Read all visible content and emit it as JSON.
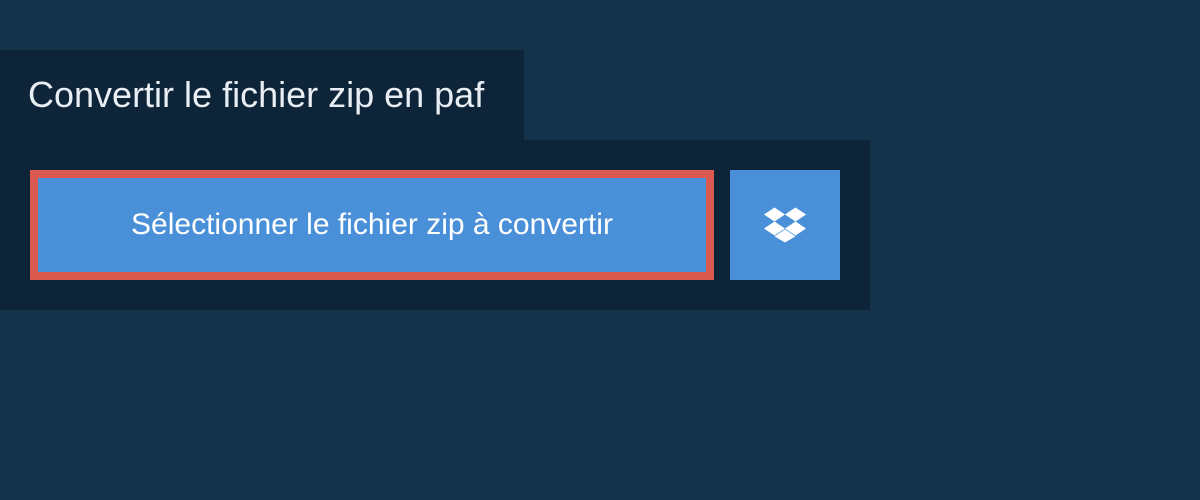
{
  "header": {
    "title": "Convertir le fichier zip en paf"
  },
  "picker": {
    "select_label": "Sélectionner le fichier zip à convertir",
    "dropbox_icon": "dropbox"
  },
  "colors": {
    "page_bg": "#14324a",
    "panel_bg": "#0e2438",
    "button_bg": "#4a90d9",
    "highlight_border": "#db5a4f",
    "text_light": "#e8eef3",
    "text_white": "#ffffff"
  }
}
